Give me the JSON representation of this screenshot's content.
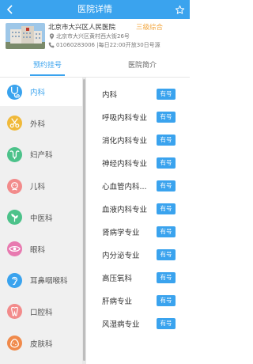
{
  "header": {
    "title": "医院详情",
    "back_icon": "chevron-left-icon",
    "star_icon": "star-outline-icon",
    "bg_color": "#3aa3ee"
  },
  "hospital": {
    "name": "北京市大兴区人民医院",
    "grade": "三级综合",
    "address": "北京市大兴区黄村西大街26号",
    "phone_hours": "01060283006 |每日22:00开放30日号源",
    "address_icon": "location-pin-icon",
    "phone_icon": "phone-icon",
    "grade_color": "#f2a43a"
  },
  "tabs": {
    "left": "预约挂号",
    "right": "医院简介",
    "active_color": "#3aa3ee"
  },
  "departments": [
    {
      "label": "内科",
      "icon": "stethoscope-icon",
      "color": "#3aa3ee",
      "active": true
    },
    {
      "label": "外科",
      "icon": "scissors-icon",
      "color": "#f0b93a"
    },
    {
      "label": "妇产科",
      "icon": "uterus-icon",
      "color": "#4cc28a"
    },
    {
      "label": "儿科",
      "icon": "baby-icon",
      "color": "#f28b8b"
    },
    {
      "label": "中医科",
      "icon": "herb-icon",
      "color": "#4cc28a"
    },
    {
      "label": "眼科",
      "icon": "eye-icon",
      "color": "#e87ab0"
    },
    {
      "label": "耳鼻咽喉科",
      "icon": "ear-icon",
      "color": "#3aa3ee"
    },
    {
      "label": "口腔科",
      "icon": "tooth-icon",
      "color": "#f28b8b"
    },
    {
      "label": "皮肤科",
      "icon": "skin-icon",
      "color": "#f08a4b"
    }
  ],
  "sub_departments": [
    {
      "label": "内科",
      "badge": "有号"
    },
    {
      "label": "呼吸内科专业",
      "badge": "有号"
    },
    {
      "label": "消化内科专业",
      "badge": "有号"
    },
    {
      "label": "神经内科专业",
      "badge": "有号"
    },
    {
      "label": "心血管内科...",
      "badge": "有号"
    },
    {
      "label": "血液内科专业",
      "badge": "有号"
    },
    {
      "label": "肾病学专业",
      "badge": "有号"
    },
    {
      "label": "内分泌专业",
      "badge": "有号"
    },
    {
      "label": "高压氧科",
      "badge": "有号"
    },
    {
      "label": "肝病专业",
      "badge": "有号"
    },
    {
      "label": "风湿病专业",
      "badge": "有号"
    }
  ]
}
